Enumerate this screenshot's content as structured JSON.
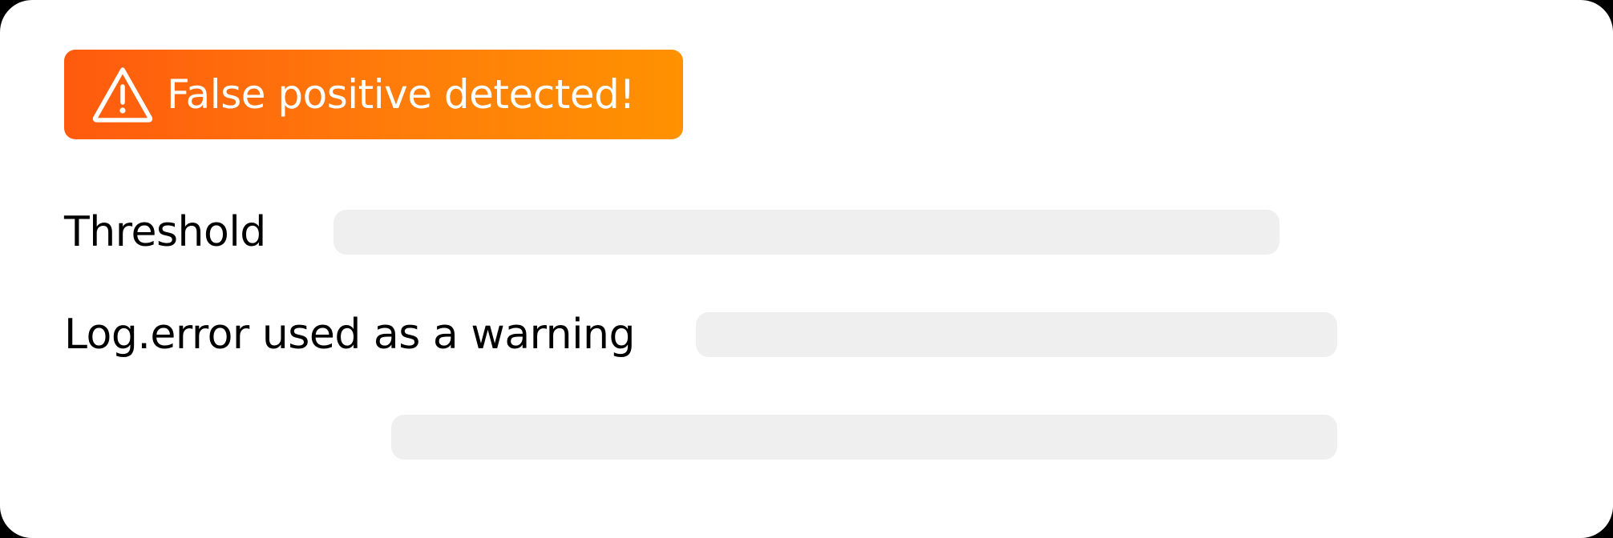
{
  "alert": {
    "icon": "warning-triangle-icon",
    "message": "False positive detected!",
    "gradient_start": "#ff5a0e",
    "gradient_end": "#ff9200"
  },
  "fields": [
    {
      "label": "Threshold"
    },
    {
      "label": "Log.error used as a warning"
    }
  ],
  "colors": {
    "placeholder_bar": "#efefef",
    "card_background": "#ffffff",
    "text": "#000000"
  }
}
